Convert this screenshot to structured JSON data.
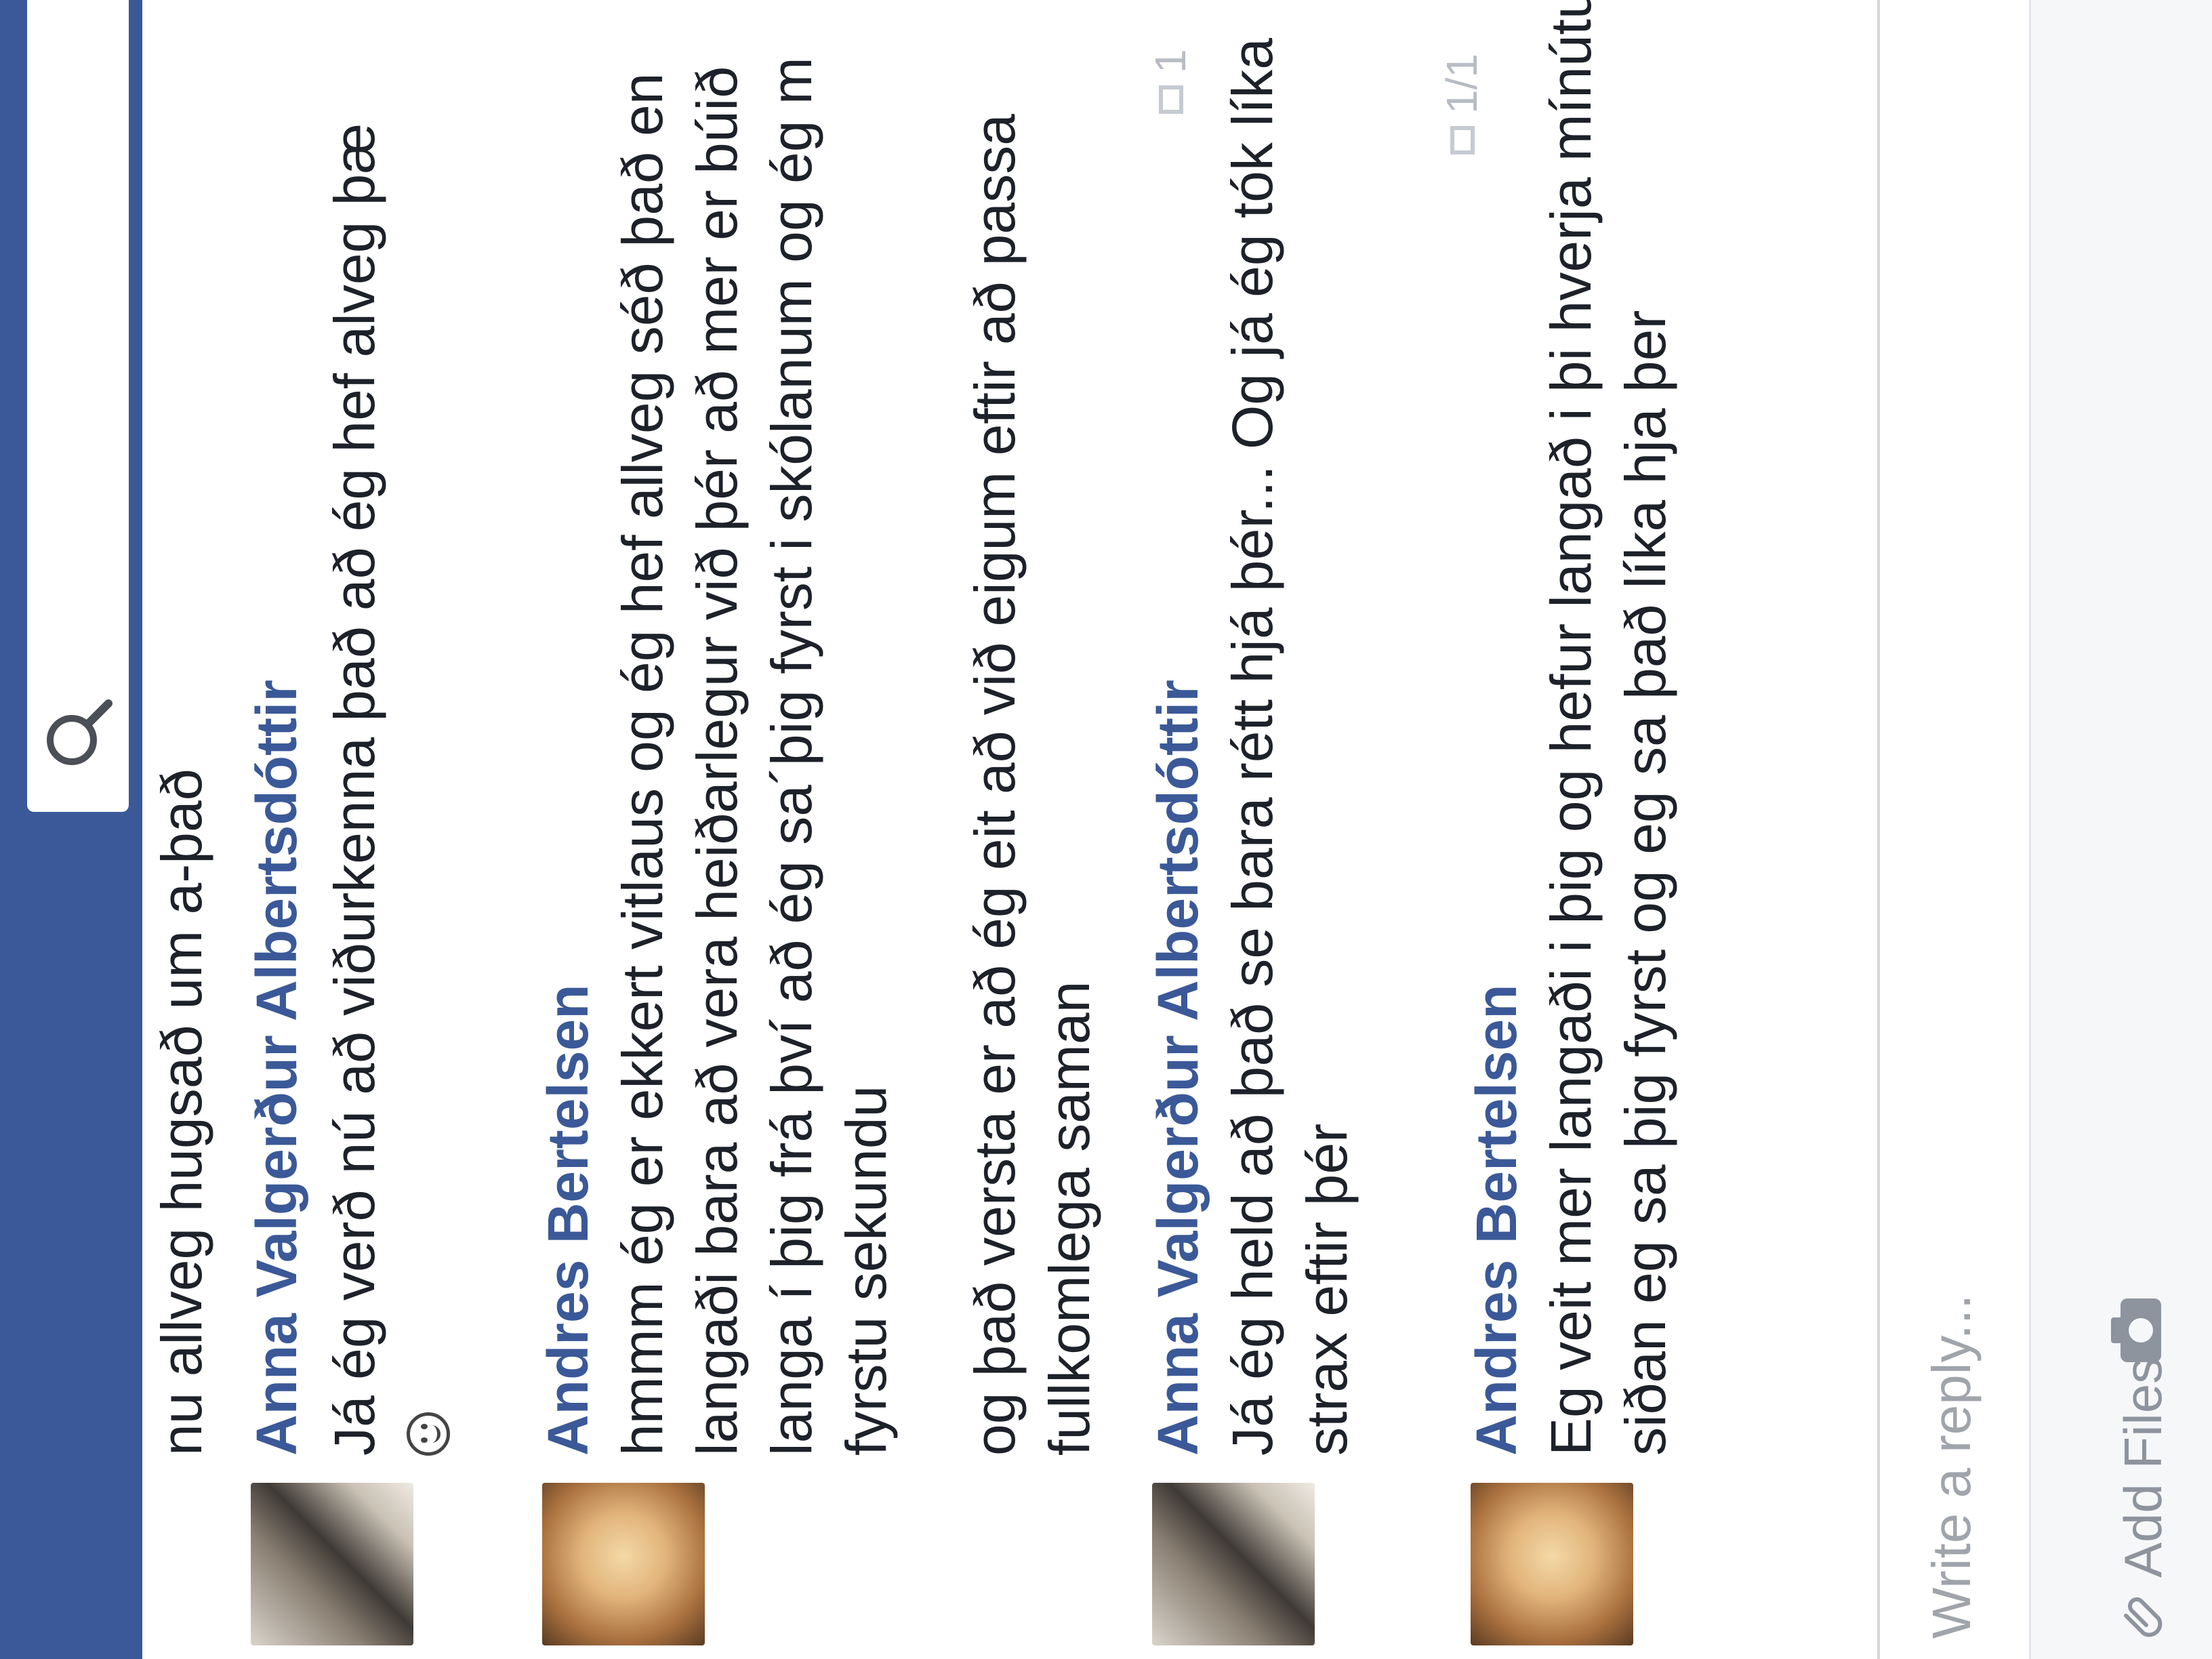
{
  "search": {
    "icon": "search-icon"
  },
  "thread": {
    "partial_line": "nu allveg hugsað um a-það",
    "messages": [
      {
        "sender": "Anna Valgerður Albertsdóttir",
        "avatar": "avatar-anna",
        "lines": [
          "Já ég verð nú að viðurkenna það að ég hef alveg þæ"
        ],
        "emoji": "smiley-icon"
      },
      {
        "sender": "Andres Bertelsen",
        "avatar": "avatar-andres",
        "lines": [
          "hmmm ég er ekkert vitlaus og ég hef allveg séð það en",
          "langaði bara að vera heiðarlegur við þér að mer er búið",
          "langa í þig frá því að ég sa´þig fyrst i skólanum og ég m",
          "fyrstu sekundu",
          "",
          "og það versta er að ég eit að við eigum eftir að passa",
          "fullkomlega saman"
        ]
      },
      {
        "sender": "Anna Valgerður Albertsdóttir",
        "avatar": "avatar-anna",
        "lines": [
          "Já ég held að það se bara rétt hjá þér... Og já ég tók líka",
          "strax eftir þér"
        ],
        "seen": "1"
      },
      {
        "sender": "Andres Bertelsen",
        "avatar": "avatar-andres",
        "lines": [
          "Eg veit mer langaði i þig og hefur langað i þi hverja mínútu",
          "siðan eg sa þig fyrst og eg sa það líka hja þer"
        ],
        "seen": "1/1"
      }
    ]
  },
  "reply": {
    "placeholder": "Write a reply...",
    "add_files": "Add Files"
  }
}
